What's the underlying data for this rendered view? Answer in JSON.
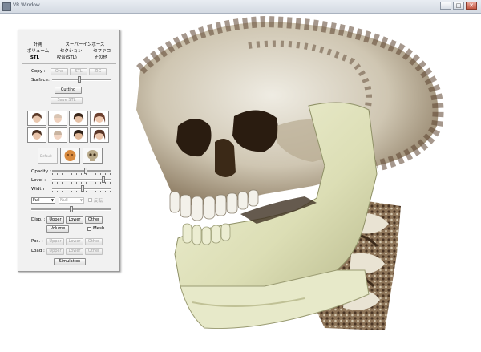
{
  "window": {
    "title": "VR Window",
    "minimize": "–",
    "maximize": "□",
    "close": "✕"
  },
  "tabs": {
    "row1": [
      "計測",
      "スーパーインポーズ"
    ],
    "row2": [
      "ボリューム",
      "セクション",
      "セファロ"
    ],
    "row3": [
      "STL",
      "咬合(STL)",
      "その他"
    ],
    "active": "STL"
  },
  "copy": {
    "label": "Copy :",
    "options": [
      "One",
      "STL",
      "ZIG"
    ]
  },
  "surface": {
    "label": "Surface:",
    "value": 0.45
  },
  "cutting_button": "Cutting",
  "save_stl_button": "Save STL",
  "face_presets": [
    "face-preset-1",
    "face-preset-2",
    "face-preset-3",
    "face-preset-4",
    "face-preset-5",
    "face-preset-6",
    "face-preset-7",
    "face-preset-8"
  ],
  "preset_buttons": {
    "default_label": "Default"
  },
  "sliders": {
    "opacity": {
      "label": "Opacity :",
      "value": 0.55
    },
    "level": {
      "label": "Level :",
      "value": 0.85
    },
    "width": {
      "label": "Width :",
      "value": 0.5
    }
  },
  "selects": {
    "first": "Full",
    "second": "Null",
    "checkbox_label": "反転"
  },
  "disp": {
    "label": "Disp. :",
    "buttons": [
      "Upper",
      "Lower",
      "Other"
    ],
    "volume": "Volume",
    "mesh": "Mesh"
  },
  "pos": {
    "label": "Pos. :",
    "buttons": [
      "Upper",
      "Lower",
      "Other"
    ]
  },
  "load": {
    "label": "Load :",
    "buttons": [
      "Upper",
      "Lower",
      "Other"
    ]
  },
  "simulation_button": "Simulation",
  "colors": {
    "bone": "#d9d2c1",
    "mandible": "#e4e6c2",
    "panel": "#f1f1f1",
    "soft_tissue": "#5c4430"
  }
}
